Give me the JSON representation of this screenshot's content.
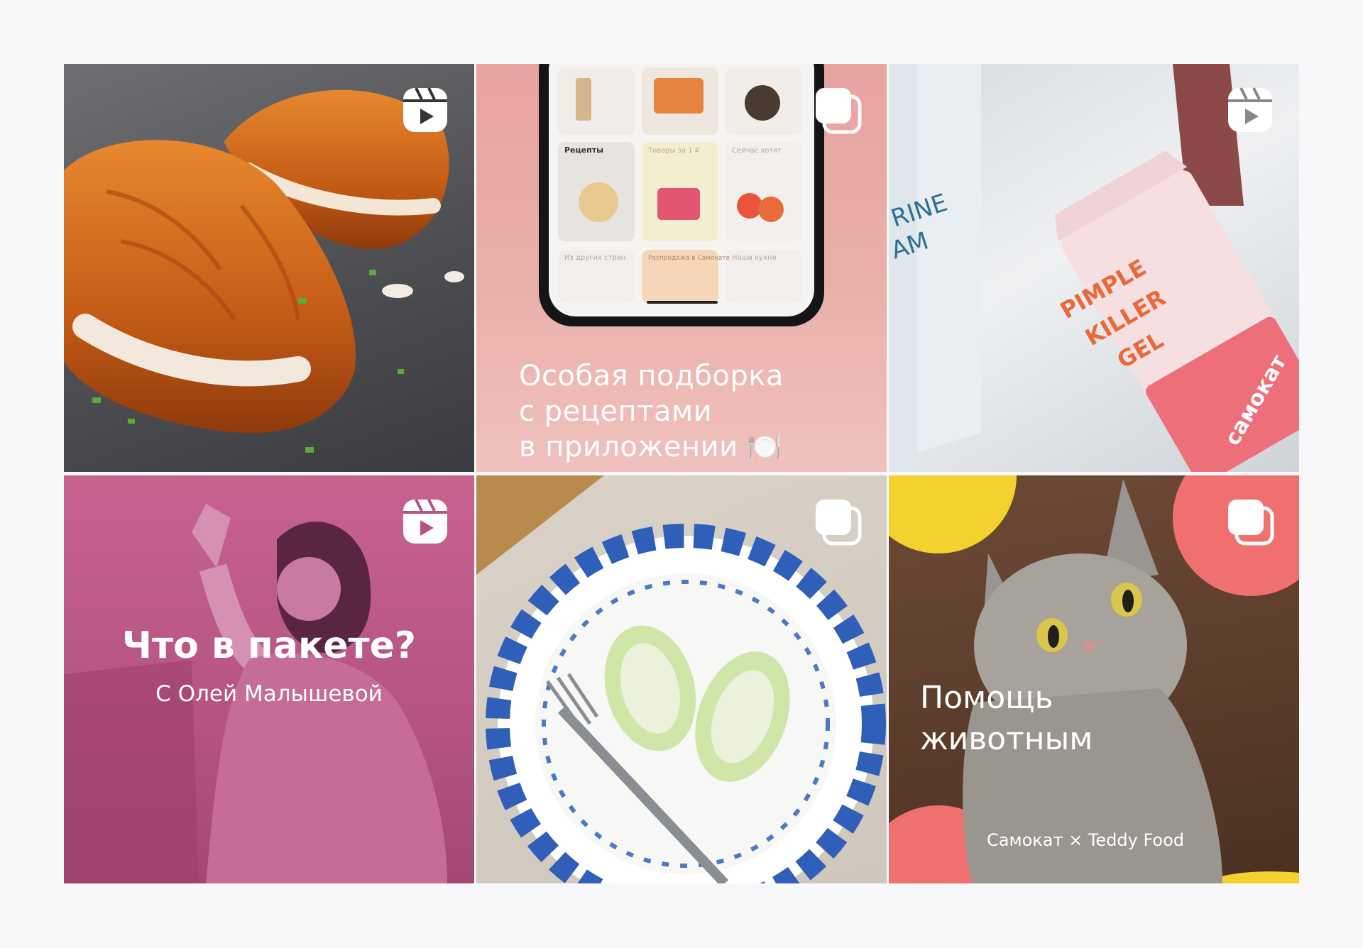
{
  "colors": {
    "page_background": "#f8f8fa",
    "badge": "#ffffff",
    "brand_pink": "#e8a3a1",
    "magenta": "#b45482",
    "coral": "#f07070",
    "yellow": "#f4d22e"
  },
  "posts": [
    {
      "type": "reel",
      "icon": "reels-icon",
      "subject": "croissants"
    },
    {
      "type": "carousel",
      "icon": "carousel-icon",
      "caption_lines": [
        "Особая подборка",
        "с рецептами",
        "в приложении 🍽️"
      ],
      "phone": {
        "tiles": [
          "Рецепты",
          "Товары за 1 ₽",
          "Сейчас хотят",
          "Из других стран",
          "Распродажа в Самокате",
          "Наша кухня"
        ]
      }
    },
    {
      "type": "reel",
      "icon": "reels-icon",
      "product_text": [
        "PIMPLE",
        "KILLER",
        "GEL"
      ],
      "bottle_text": "RINE\nAM",
      "brand_text": "самокат"
    },
    {
      "type": "reel",
      "icon": "reels-icon",
      "title": "Что в пакете?",
      "subtitle": "С Олей Малышевой"
    },
    {
      "type": "carousel",
      "icon": "carousel-icon",
      "subject": "plate"
    },
    {
      "type": "carousel",
      "icon": "carousel-icon",
      "title_lines": [
        "Помощь",
        "животным"
      ],
      "subtitle": "Самокат × Teddy Food"
    }
  ]
}
